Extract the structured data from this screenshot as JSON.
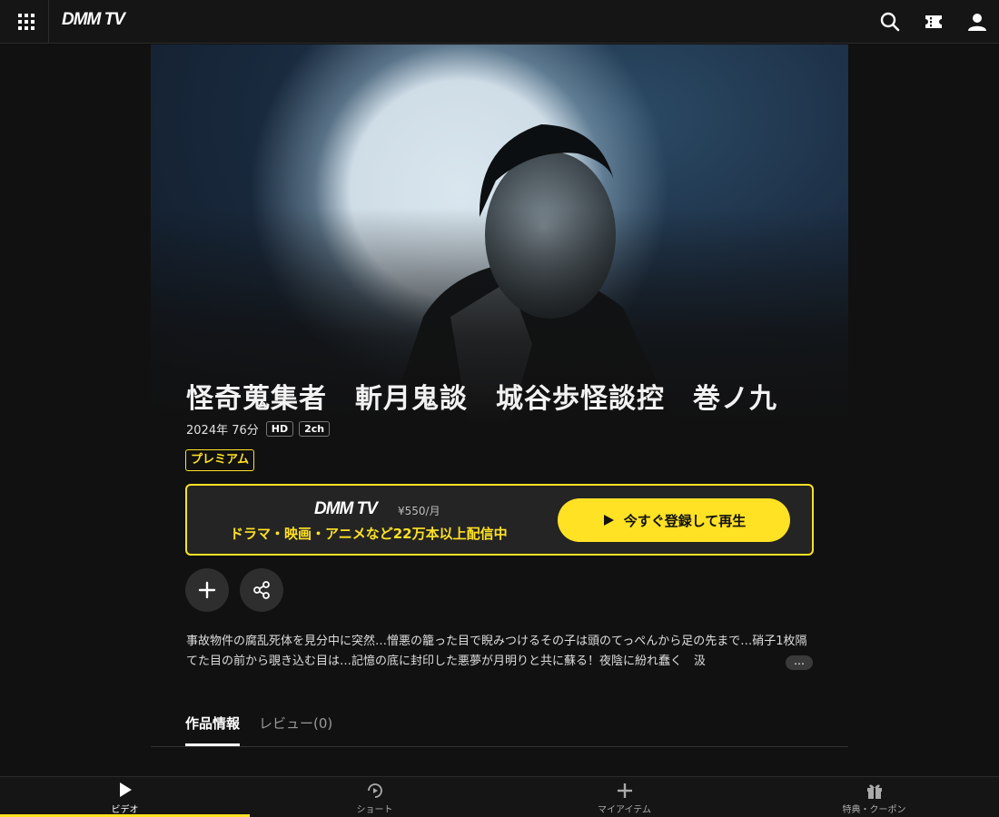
{
  "header": {
    "logo": "DMM TV",
    "icons": [
      "apps-grid-icon",
      "search-icon",
      "ticket-icon",
      "user-icon"
    ]
  },
  "title": {
    "text": "怪奇蒐集者　斬月鬼談　城谷歩怪談控　巻ノ九",
    "meta_text": "2024年  76分",
    "tag_hd": "HD",
    "tag_ch": "2ch",
    "badge": "プレミアム"
  },
  "promo": {
    "logo": "DMM TV",
    "price": "¥550/月",
    "description": "ドラマ・映画・アニメなど22万本以上配信中",
    "play_button_label": "今すぐ登録して再生"
  },
  "actions": [
    "add-icon",
    "share-icon"
  ],
  "synopsis": {
    "text": "事故物件の腐乱死体を見分中に突然…憎悪の籠った目で睨みつけるその子は頭のてっぺんから足の先まで…硝子1枚隔てた目の前から覗き込む目は…記憶の底に封印した悪夢が月明りと共に蘇る！夜陰に紛れ蠢く　汲",
    "more_label": "…"
  },
  "tabs": [
    {
      "label": "作品情報",
      "active": true
    },
    {
      "label": "レビュー(0)",
      "active": false
    }
  ],
  "bottom_nav": [
    {
      "label": "ビデオ",
      "icon": "play-icon",
      "active": true
    },
    {
      "label": "ショート",
      "icon": "shorts-icon",
      "active": false
    },
    {
      "label": "マイアイテム",
      "icon": "plus-icon",
      "active": false
    },
    {
      "label": "特典・クーポン",
      "icon": "gift-icon",
      "active": false
    }
  ],
  "colors": {
    "accent": "#ffe224",
    "background": "#111111"
  }
}
